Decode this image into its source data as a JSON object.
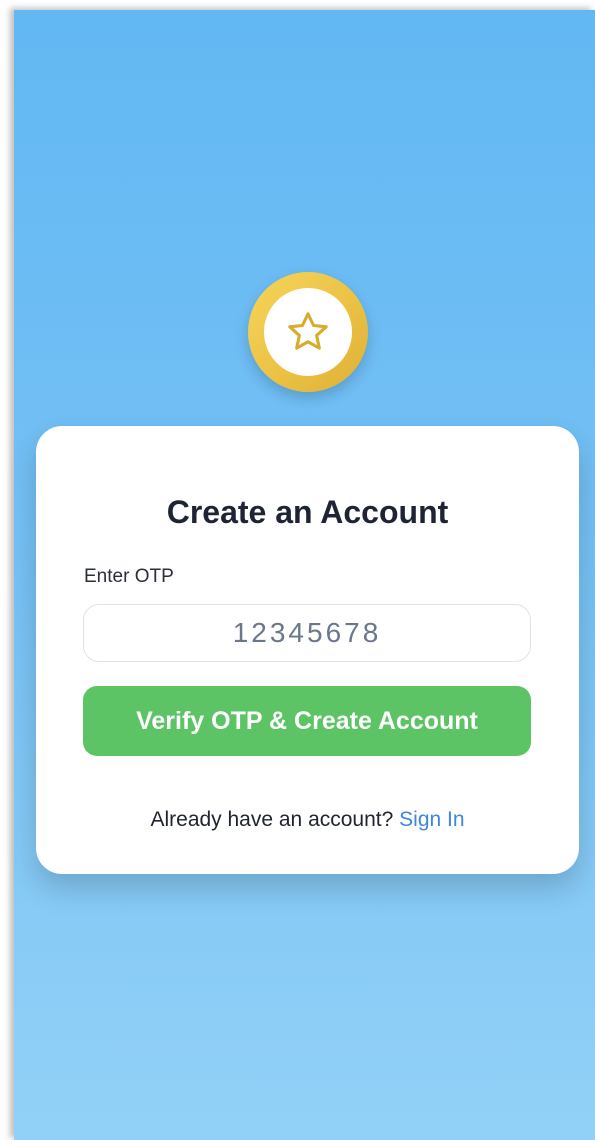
{
  "header": {
    "title": "Create an Account"
  },
  "form": {
    "otp_label": "Enter OTP",
    "otp_placeholder": "12345678",
    "otp_value": "",
    "submit_label": "Verify OTP & Create Account"
  },
  "footer": {
    "prompt": "Already have an account?",
    "link_label": "Sign In"
  },
  "icons": {
    "logo": "star-icon"
  },
  "colors": {
    "background_top": "#62b8f3",
    "background_bottom": "#92d1f7",
    "logo_ring": "#ebc244",
    "star_outline": "#d9ab2b",
    "button": "#5cc465",
    "link": "#3f86e0",
    "title": "#1e2433"
  }
}
